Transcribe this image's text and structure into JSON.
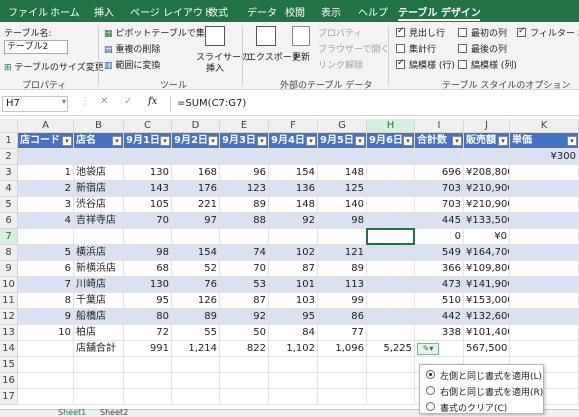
{
  "ribbon_tabs": [
    "ファイル",
    "ホーム",
    "挿入",
    "ページ レイアウト",
    "数式",
    "データ",
    "校閲",
    "表示",
    "ヘルプ",
    "テーブル デザイン"
  ],
  "ribbon": {
    "table_name_label": "テーブル名:",
    "table_name_value": "テーブル2",
    "resize_table": "テーブルのサイズ変更",
    "group_properties": "プロパティ",
    "pivot_summary": "ピボットテーブルで集計",
    "remove_duplicates": "重複の削除",
    "convert_to_range": "範囲に変換",
    "slicer": "スライサーの",
    "slicer2": "挿入",
    "group_tools": "ツール",
    "export": "エクスポート",
    "refresh": "更新",
    "properties": "プロパティ",
    "open_in_browser": "ブラウザーで開く",
    "unlink": "リンク解除",
    "group_external": "外部のテーブル データ",
    "header_row": "見出し行",
    "total_row": "集計行",
    "banded_rows": "縞模様 (行)",
    "first_column": "最初の列",
    "last_column": "最後の列",
    "banded_columns": "縞模様 (列)",
    "filter_button": "フィルター ボタン",
    "group_style_options": "テーブル スタイルのオプション"
  },
  "formula_bar": {
    "name_box": "H7",
    "fx": "fx",
    "formula": "=SUM(C7:G7)"
  },
  "columns": [
    "A",
    "B",
    "C",
    "D",
    "E",
    "F",
    "G",
    "H",
    "I",
    "J",
    "K"
  ],
  "rows": [
    "1",
    "2",
    "3",
    "4",
    "5",
    "6",
    "7",
    "8",
    "9",
    "10",
    "11",
    "12",
    "13",
    "14",
    "15",
    "16",
    "17"
  ],
  "table_headers": [
    "店コード",
    "店名",
    "9月1日",
    "9月2日",
    "9月3日",
    "9月4日",
    "9月5日",
    "9月6日",
    "合計数",
    "販売額",
    "単価"
  ],
  "unit_price": "¥300",
  "table_rows": [
    [
      "1",
      "池袋店",
      "130",
      "168",
      "96",
      "154",
      "148",
      "",
      "696",
      "¥208,800",
      ""
    ],
    [
      "2",
      "新宿店",
      "143",
      "176",
      "123",
      "136",
      "125",
      "",
      "703",
      "¥210,900",
      ""
    ],
    [
      "3",
      "渋谷店",
      "105",
      "221",
      "89",
      "148",
      "140",
      "",
      "703",
      "¥210,900",
      ""
    ],
    [
      "4",
      "吉祥寺店",
      "70",
      "97",
      "88",
      "92",
      "98",
      "",
      "445",
      "¥133,500",
      ""
    ],
    [
      "",
      "",
      "",
      "",
      "",
      "",
      "",
      "",
      "0",
      "¥0",
      ""
    ],
    [
      "5",
      "横浜店",
      "98",
      "154",
      "74",
      "102",
      "121",
      "",
      "549",
      "¥164,700",
      ""
    ],
    [
      "6",
      "新横浜店",
      "68",
      "52",
      "70",
      "87",
      "89",
      "",
      "366",
      "¥109,800",
      ""
    ],
    [
      "7",
      "川崎店",
      "130",
      "76",
      "53",
      "101",
      "113",
      "",
      "473",
      "¥141,900",
      ""
    ],
    [
      "8",
      "千葉店",
      "95",
      "126",
      "87",
      "103",
      "99",
      "",
      "510",
      "¥153,000",
      ""
    ],
    [
      "9",
      "船橋店",
      "80",
      "89",
      "92",
      "95",
      "86",
      "",
      "442",
      "¥132,600",
      ""
    ],
    [
      "10",
      "柏店",
      "72",
      "55",
      "50",
      "84",
      "77",
      "",
      "338",
      "¥101,400",
      ""
    ]
  ],
  "total_row": [
    "",
    "店舗合計",
    "991",
    "1,214",
    "822",
    "1,102",
    "1,096",
    "5,225",
    "",
    "567,500",
    ""
  ],
  "autofill_options": {
    "opt1": "左側と同じ書式を適用(L)",
    "opt2": "右側と同じ書式を適用(R)",
    "opt3": "書式のクリア(C)"
  },
  "sheet_tabs": [
    "Sheet1",
    "Sheet2"
  ]
}
